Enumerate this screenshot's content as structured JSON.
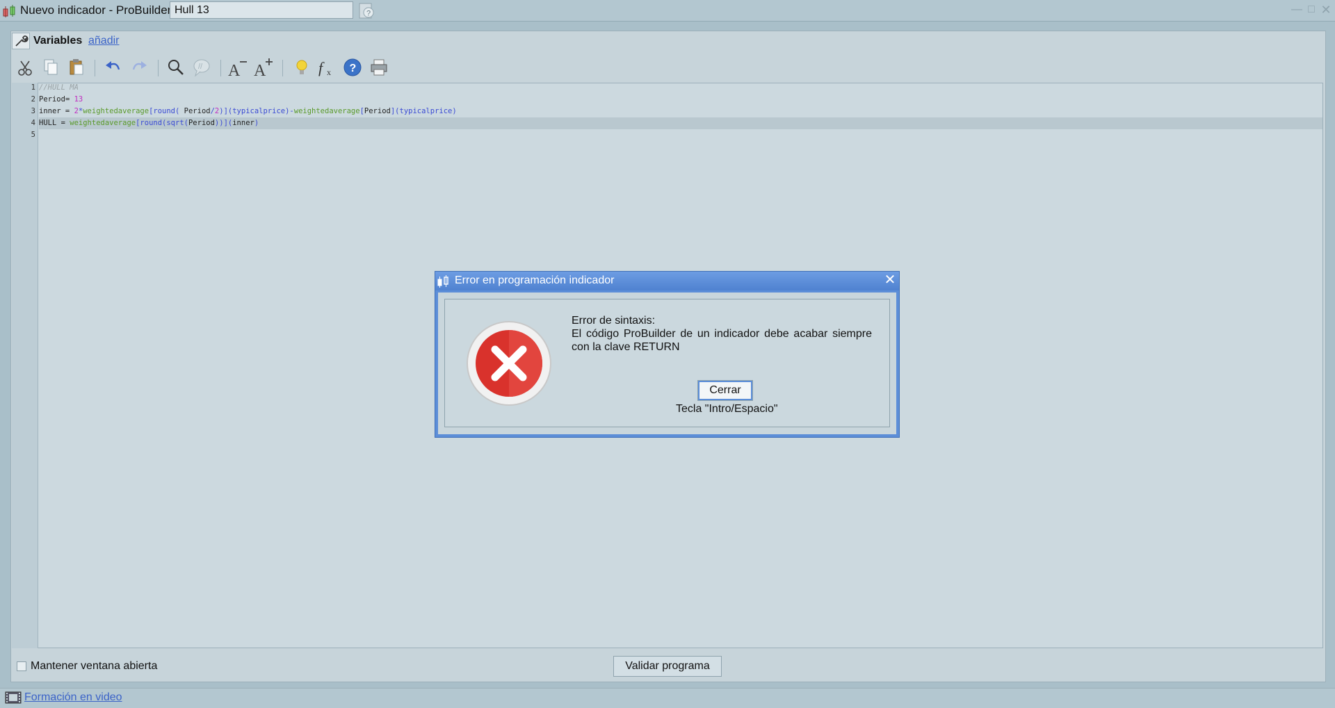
{
  "window": {
    "title": "Nuevo indicador - ProBuilder -",
    "indicator_name": "Hull 13"
  },
  "variables": {
    "label": "Variables",
    "add_link": "añadir"
  },
  "toolbar": {
    "icons": [
      "scissors-icon",
      "copy-icon",
      "paste-icon",
      "undo-icon",
      "redo-icon",
      "search-icon",
      "comment-icon",
      "font-decrease-icon",
      "font-increase-icon",
      "lightbulb-icon",
      "function-icon",
      "help-icon",
      "print-icon"
    ]
  },
  "editor": {
    "line_numbers": [
      "1",
      "2",
      "3",
      "4",
      "5"
    ],
    "lines": [
      "//HULL MA",
      "Period= 13",
      "inner = 2*weightedaverage[round( Period/2)](typicalprice)-weightedaverage[Period](typicalprice)",
      "HULL = weightedaverage[round(sqrt(Period))](inner)",
      ""
    ]
  },
  "bottom": {
    "keep_open_label": "Mantener ventana abierta",
    "validate_button": "Validar programa",
    "video_link": "Formación en video"
  },
  "dialog": {
    "title": "Error en programación indicador",
    "message_title": "Error de sintaxis:",
    "message_body": "El código ProBuilder de un indicador debe acabar siempre con la clave RETURN",
    "close_button": "Cerrar",
    "key_hint": "Tecla \"Intro/Espacio\"",
    "colors": {
      "titlebar": "#5c8ed8",
      "error_red": "#d9322c"
    }
  }
}
